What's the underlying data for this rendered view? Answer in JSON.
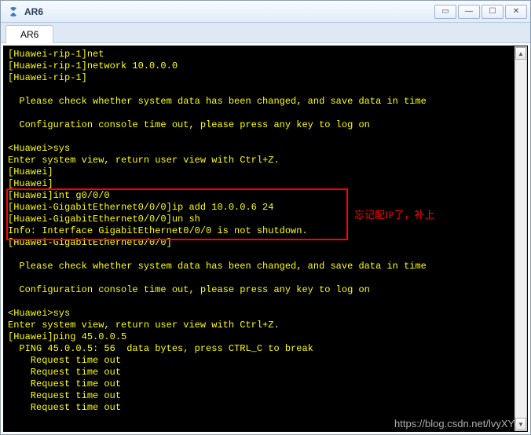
{
  "window": {
    "title": "AR6",
    "controls": {
      "extra": "▭",
      "min": "—",
      "max": "☐",
      "close": "✕"
    }
  },
  "tabs": [
    {
      "label": "AR6"
    }
  ],
  "terminal": {
    "lines": [
      "[Huawei-rip-1]net",
      "[Huawei-rip-1]network 10.0.0.0",
      "[Huawei-rip-1]",
      "",
      "  Please check whether system data has been changed, and save data in time",
      "",
      "  Configuration console time out, please press any key to log on",
      "",
      "<Huawei>sys",
      "Enter system view, return user view with Ctrl+Z.",
      "[Huawei]",
      "[Huawei]",
      "[Huawei]int g0/0/0",
      "[Huawei-GigabitEthernet0/0/0]ip add 10.0.0.6 24",
      "[Huawei-GigabitEthernet0/0/0]un sh",
      "Info: Interface GigabitEthernet0/0/0 is not shutdown.",
      "[Huawei-GigabitEthernet0/0/0]",
      "",
      "  Please check whether system data has been changed, and save data in time",
      "",
      "  Configuration console time out, please press any key to log on",
      "",
      "<Huawei>sys",
      "Enter system view, return user view with Ctrl+Z.",
      "[Huawei]ping 45.0.0.5",
      "  PING 45.0.0.5: 56  data bytes, press CTRL_C to break",
      "    Request time out",
      "    Request time out",
      "    Request time out",
      "    Request time out",
      "    Request time out"
    ]
  },
  "annotation": {
    "text": "忘记配IP了，补上"
  },
  "watermark": {
    "text": "https://blog.csdn.net/lvyXYv"
  }
}
